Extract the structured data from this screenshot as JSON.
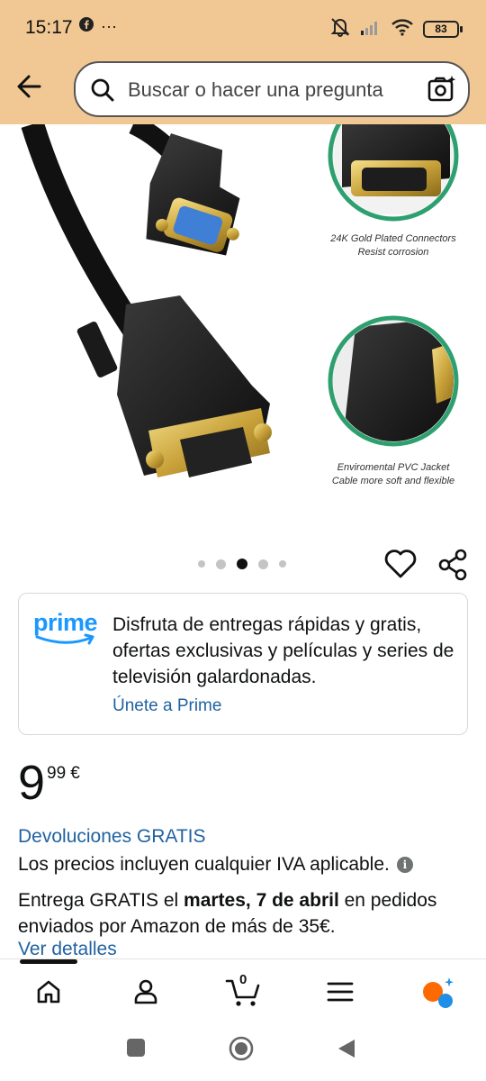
{
  "status_bar": {
    "time": "15:17",
    "more": "···",
    "battery": "83"
  },
  "search": {
    "placeholder": "Buscar o hacer una pregunta"
  },
  "product_image": {
    "callout_1": "24K Gold Plated Connectors\nResist corrosion",
    "callout_1_line1": "24K Gold Plated Connectors",
    "callout_1_line2": "Resist corrosion",
    "callout_2_line1": "Enviromental PVC Jacket",
    "callout_2_line2": "Cable more soft and flexible",
    "carousel_total": 5,
    "carousel_active": 3
  },
  "prime": {
    "logo": "prime",
    "text": "Disfruta de entregas rápidas y gratis, ofertas exclusivas y películas y series de televisión galardonadas.",
    "link": "Únete a Prime"
  },
  "price": {
    "whole": "9",
    "fraction": "99",
    "currency": "€"
  },
  "returns_link": "Devoluciones GRATIS",
  "vat_text": "Los precios incluyen cualquier IVA aplicable.",
  "delivery": {
    "prefix": "Entrega GRATIS el ",
    "date": "martes, 7 de abril",
    "suffix": " en pedidos enviados por Amazon de más de 35€."
  },
  "details_link": "Ver detalles",
  "bottom_nav": {
    "cart_count": "0"
  },
  "colors": {
    "header_bg": "#f1c894",
    "link": "#2162a1",
    "prime_blue": "#1a98ff",
    "teal_ring": "#2e9f6e",
    "assistant_orange": "#ff6a00",
    "assistant_blue": "#1f8fe5"
  }
}
